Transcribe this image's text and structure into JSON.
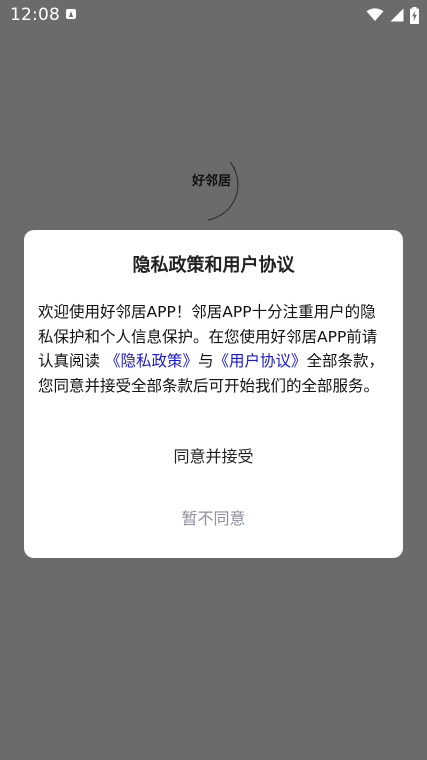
{
  "status_bar": {
    "time": "12:08",
    "icons": [
      "notification-a-icon",
      "wifi-icon",
      "signal-icon",
      "battery-charging-icon"
    ]
  },
  "splash": {
    "app_name": "好邻居"
  },
  "dialog": {
    "title": "隐私政策和用户协议",
    "body_part1": "欢迎使用好邻居APP！邻居APP十分注重用户的隐私保护和个人信息保护。在您使用好邻居APP前请认真阅读",
    "privacy_link": "《隐私政策》",
    "body_and": "与",
    "agreement_link": "《用户协议》",
    "body_part2": "全部条款，您同意并接受全部条款后可开始我们的全部服务。",
    "agree_label": "同意并接受",
    "disagree_label": "暂不同意"
  },
  "colors": {
    "overlay": "#6b6b6b",
    "link": "#1a1acc",
    "disagree_text": "#8e8e9c"
  }
}
